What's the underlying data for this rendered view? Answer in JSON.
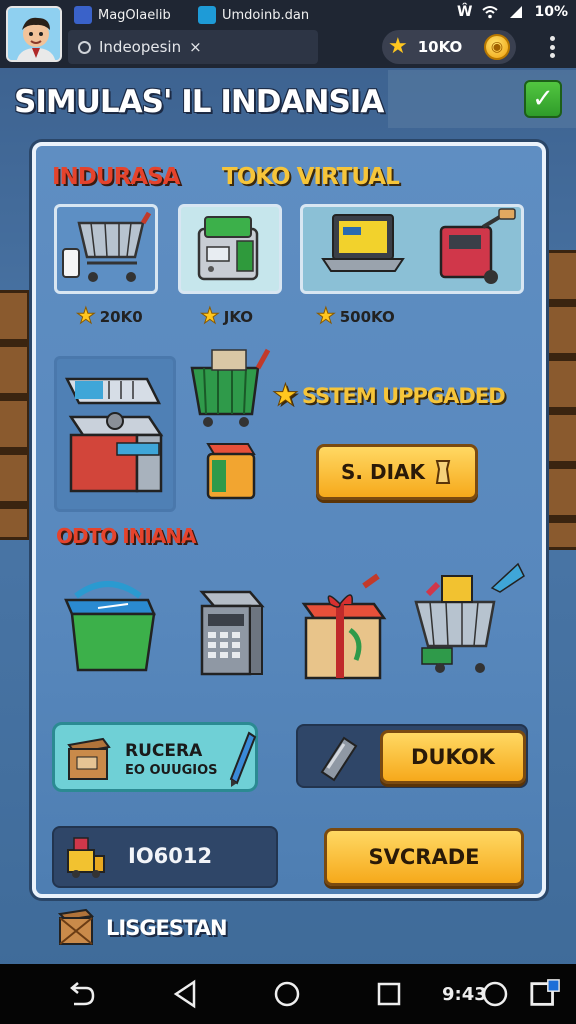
{
  "browser": {
    "tabs": [
      {
        "label": "MagOlaelib"
      },
      {
        "label": "Umdoinb.dan"
      }
    ],
    "address_text": "Indeopesin",
    "address_close": "×",
    "status_battery": "10%",
    "status_network": "Ŵ"
  },
  "hud": {
    "coin_amount": "10KO",
    "coin_symbol": "◉"
  },
  "game": {
    "title": "SIMULAS' IL INDANSIA",
    "confirm_glyph": "✓"
  },
  "panel": {
    "header_left": "INDURASA",
    "header_right": "TOKO VIRTUAL",
    "shop_items": [
      {
        "name": "shopping-cart",
        "price": "20K0"
      },
      {
        "name": "cash-register",
        "price": "JKO"
      },
      {
        "name": "laptop-terminal",
        "price": "500KO"
      }
    ],
    "upgrade_banner": "SSTEM UPPGADED",
    "deal_button": "S. DIAK",
    "section_label": "ODTO INIANA",
    "bundle_card_line1": "RUCERA",
    "bundle_card_line2": "EO OUUGIOS",
    "dukok_button": "DUKOK",
    "balance_value": "IO6012",
    "upgrade_button": "SVCRADE"
  },
  "footer": {
    "label": "LISGESTAN"
  },
  "nav": {
    "time": "9:43"
  },
  "colors": {
    "accent_yellow": "#f6a91b",
    "header_red": "#e5432c",
    "header_yellow": "#f6c53a",
    "panel_blue": "#5f8ec2",
    "confirm_green": "#3fb335"
  }
}
